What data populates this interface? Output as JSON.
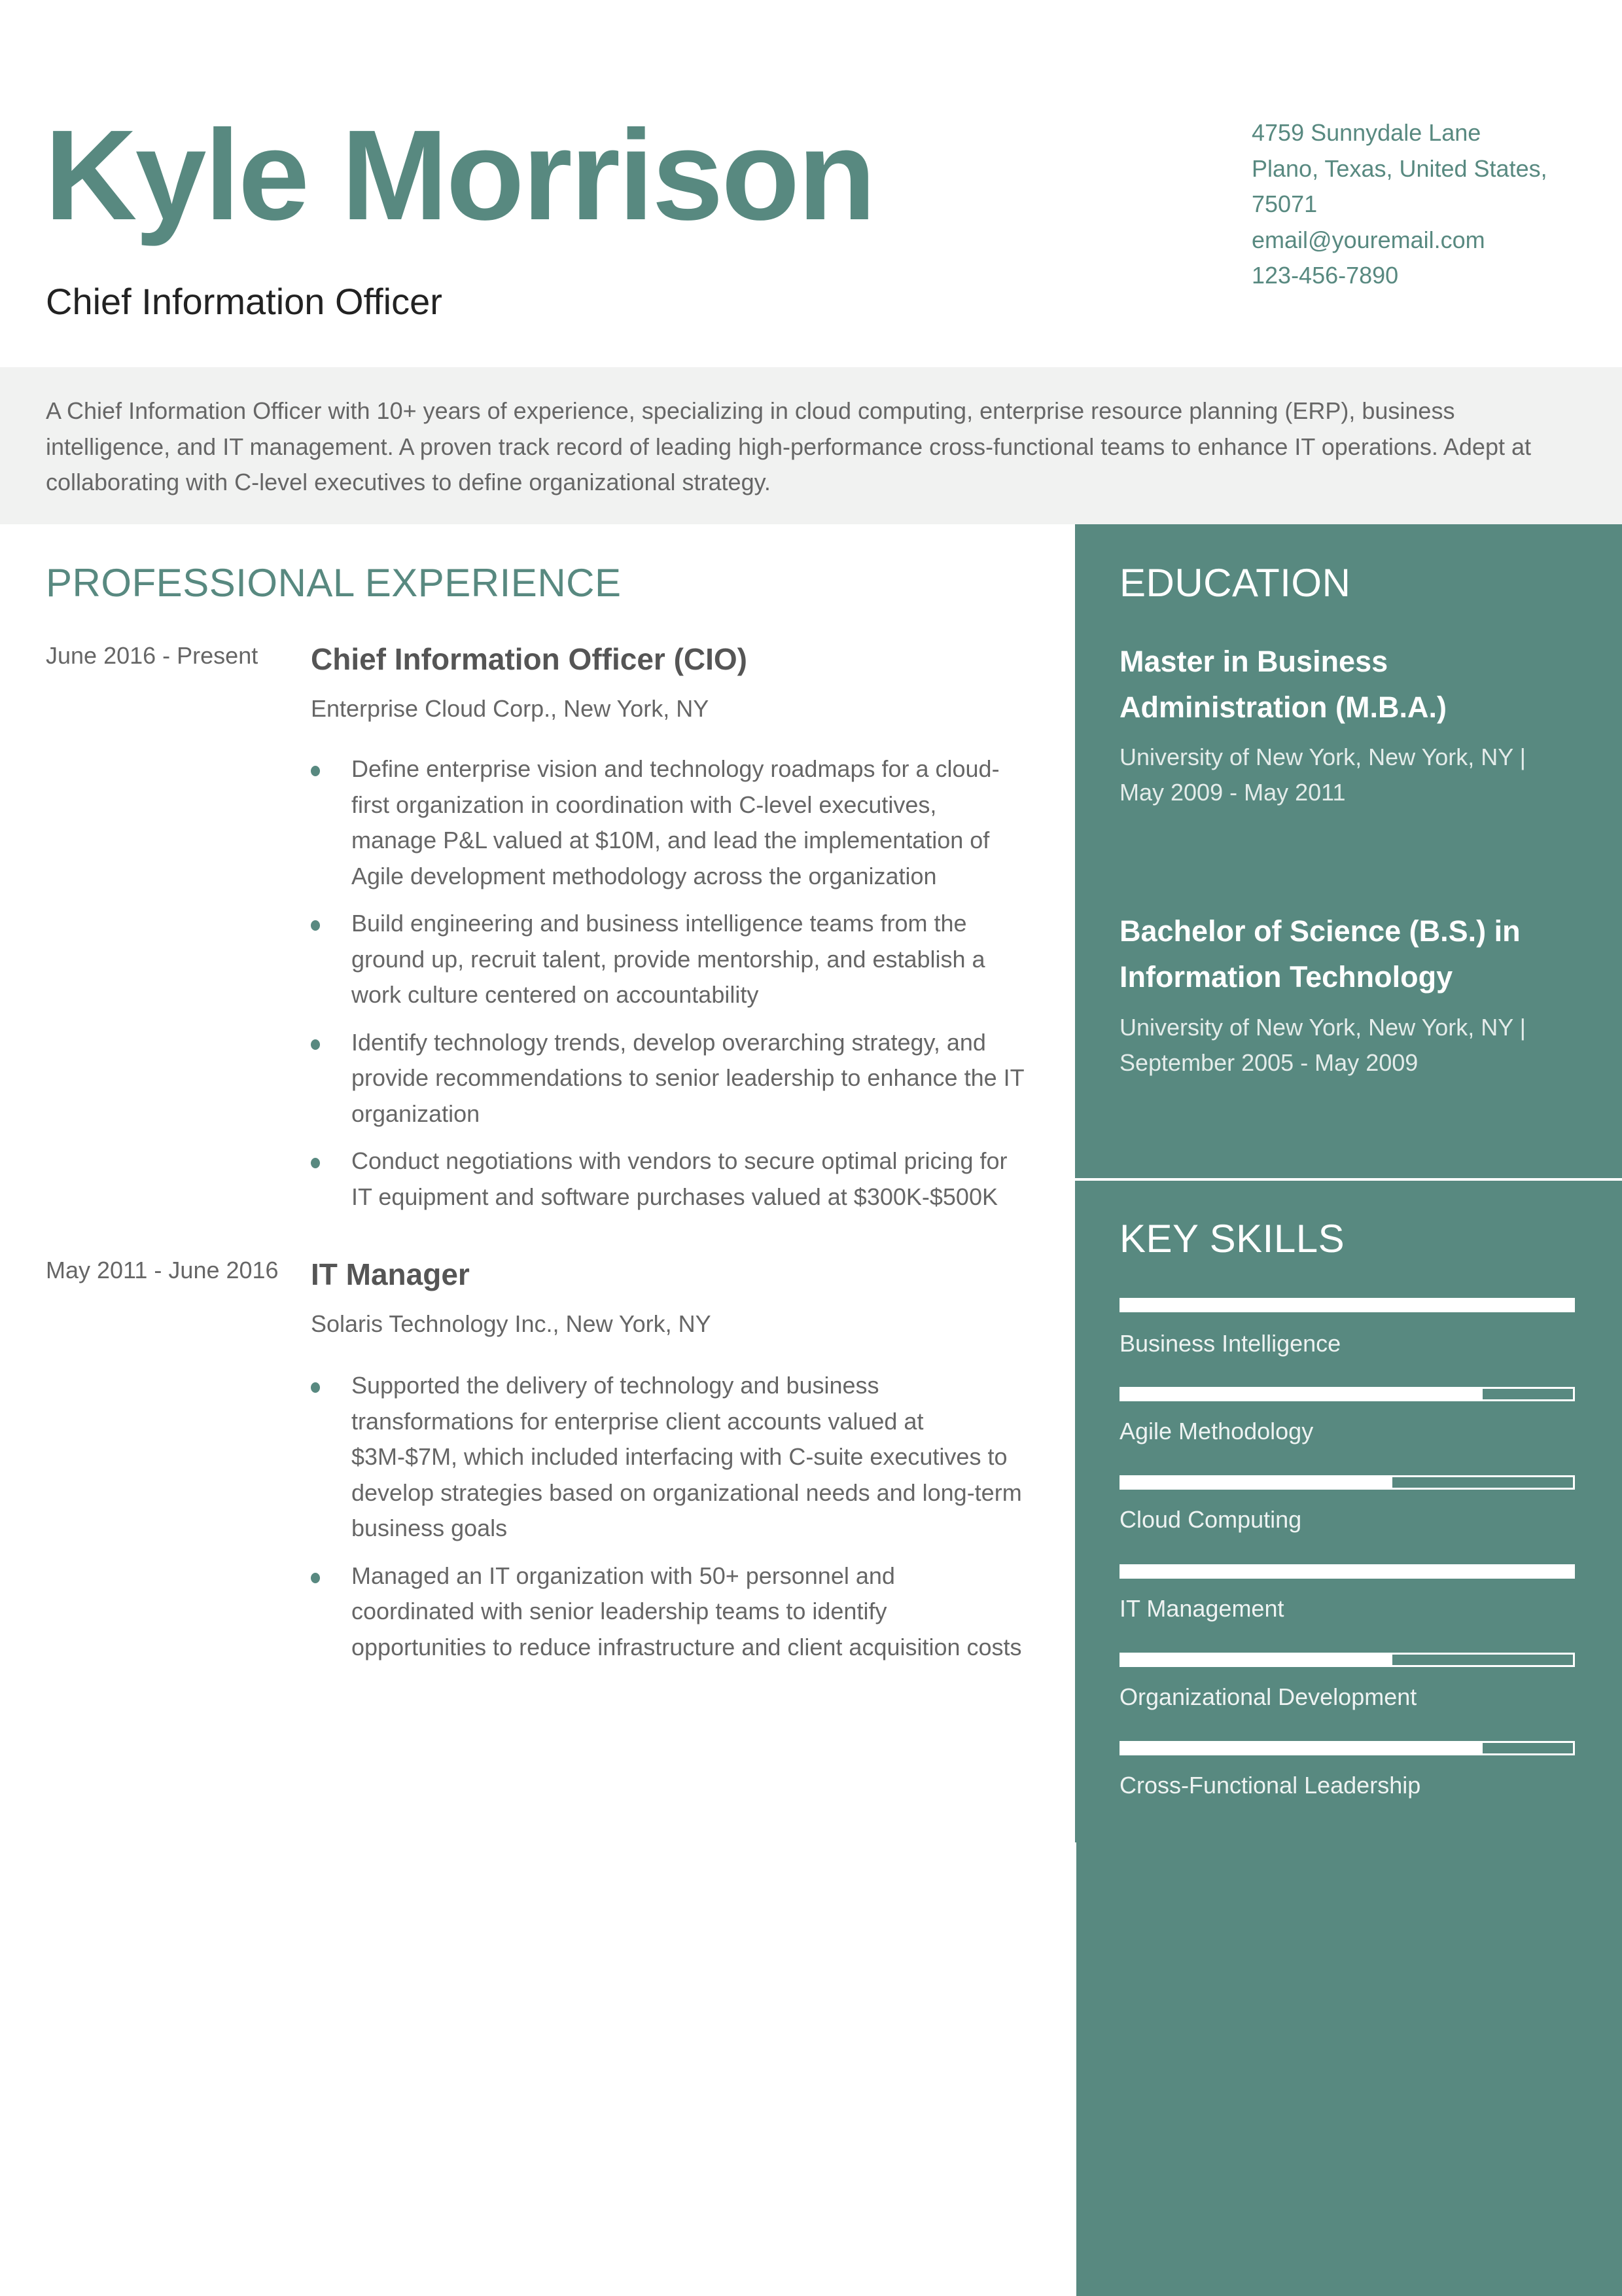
{
  "theme": {
    "accent": "#588980",
    "summary_background": "#f1f2f1",
    "body_text": "#666666"
  },
  "header": {
    "name": "Kyle Morrison",
    "title": "Chief Information Officer",
    "contact": {
      "address_line1": "4759 Sunnydale Lane",
      "address_line2": "Plano, Texas, United States,",
      "address_line3": "75071",
      "email": "email@youremail.com",
      "phone": "123-456-7890"
    }
  },
  "summary": "A Chief Information Officer with 10+ years of experience, specializing in cloud computing, enterprise resource planning (ERP), business intelligence, and IT management. A proven track record of leading high-performance cross-functional teams to enhance IT operations. Adept at collaborating with C-level executives to define organizational strategy.",
  "experience": {
    "heading": "PROFESSIONAL EXPERIENCE",
    "jobs": [
      {
        "dates": "June 2016 - Present",
        "role": "Chief Information Officer (CIO)",
        "company": "Enterprise Cloud Corp., New York, NY",
        "bullets": [
          "Define enterprise vision and technology roadmaps for a cloud-first organization in coordination with C-level executives, manage P&L valued at $10M, and lead the implementation of Agile development methodology across the organization",
          "Build engineering and business intelligence teams from the ground up, recruit talent, provide mentorship, and establish a work culture centered on accountability",
          "Identify technology trends, develop overarching strategy, and provide recommendations to senior leadership to enhance the IT organization",
          "Conduct negotiations with vendors to secure optimal pricing for IT equipment and software purchases valued at $300K-$500K"
        ]
      },
      {
        "dates": "May 2011 - June 2016",
        "role": "IT Manager",
        "company": "Solaris Technology Inc., New York, NY",
        "bullets": [
          "Supported the delivery of technology and business transformations for enterprise client accounts valued at $3M-$7M, which included interfacing with C-suite executives to develop strategies based on organizational needs and long-term business goals",
          "Managed an IT organization with 50+ personnel and coordinated with senior leadership teams to identify opportunities to reduce infrastructure and client acquisition costs"
        ]
      }
    ]
  },
  "education": {
    "heading": "EDUCATION",
    "items": [
      {
        "degree": "Master in Business Administration (M.B.A.)",
        "details": "University of New York, New York, NY | May 2009 - May 2011"
      },
      {
        "degree": "Bachelor of Science (B.S.) in Information Technology",
        "details": "University of New York, New York, NY | September 2005 - May 2009"
      }
    ]
  },
  "skills": {
    "heading": "KEY SKILLS",
    "items": [
      {
        "name": "Business Intelligence",
        "level": 1.0
      },
      {
        "name": "Agile Methodology",
        "level": 0.8
      },
      {
        "name": "Cloud Computing",
        "level": 0.6
      },
      {
        "name": "IT Management",
        "level": 1.0
      },
      {
        "name": "Organizational Development",
        "level": 0.6
      },
      {
        "name": "Cross-Functional Leadership",
        "level": 0.8
      }
    ]
  }
}
